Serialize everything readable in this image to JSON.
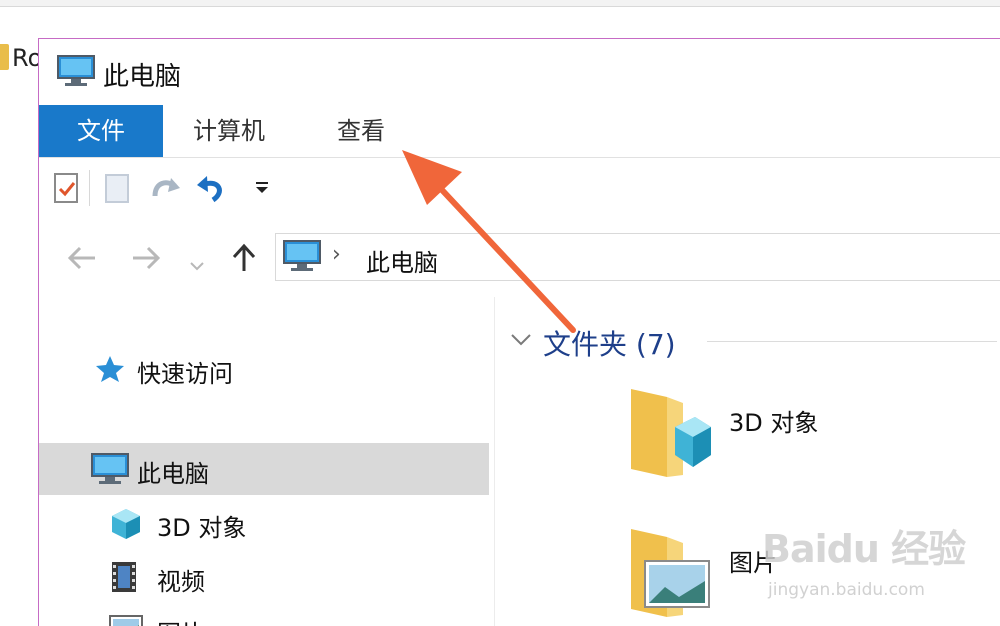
{
  "background": {
    "partial_text": "Ro"
  },
  "window": {
    "title": "此电脑"
  },
  "ribbon": {
    "tabs": [
      {
        "label": "文件",
        "active": true
      },
      {
        "label": "计算机",
        "active": false
      },
      {
        "label": "查看",
        "active": false
      }
    ]
  },
  "quick_access_toolbar": {
    "icons": [
      "properties-icon",
      "new-folder-icon",
      "redo-icon",
      "undo-icon",
      "customize-dropdown-icon"
    ]
  },
  "address_bar": {
    "separator": "›",
    "path": "此电脑",
    "icons": [
      "back-icon",
      "forward-icon",
      "recent-dropdown-icon",
      "up-icon",
      "computer-icon"
    ]
  },
  "sidebar": {
    "items": [
      {
        "label": "快速访问",
        "icon": "star-icon",
        "selected": false
      },
      {
        "label": "此电脑",
        "icon": "computer-icon",
        "selected": true
      },
      {
        "label": "3D 对象",
        "icon": "cube-icon",
        "selected": false
      },
      {
        "label": "视频",
        "icon": "film-icon",
        "selected": false
      },
      {
        "label": "图片",
        "icon": "picture-icon",
        "selected": false
      }
    ]
  },
  "content": {
    "group_label": "文件夹 (7)",
    "items": [
      {
        "label": "3D 对象",
        "icon": "folder-3d-icon"
      },
      {
        "label": "图片",
        "icon": "folder-pictures-icon"
      }
    ]
  },
  "annotation": {
    "color": "#f0663a"
  },
  "watermark": {
    "main": "Baidu 经验",
    "sub": "jingyan.baidu.com"
  },
  "colors": {
    "accent": "#1979ca",
    "selection": "#d9d9d9",
    "group_heading": "#1e3f8a"
  }
}
